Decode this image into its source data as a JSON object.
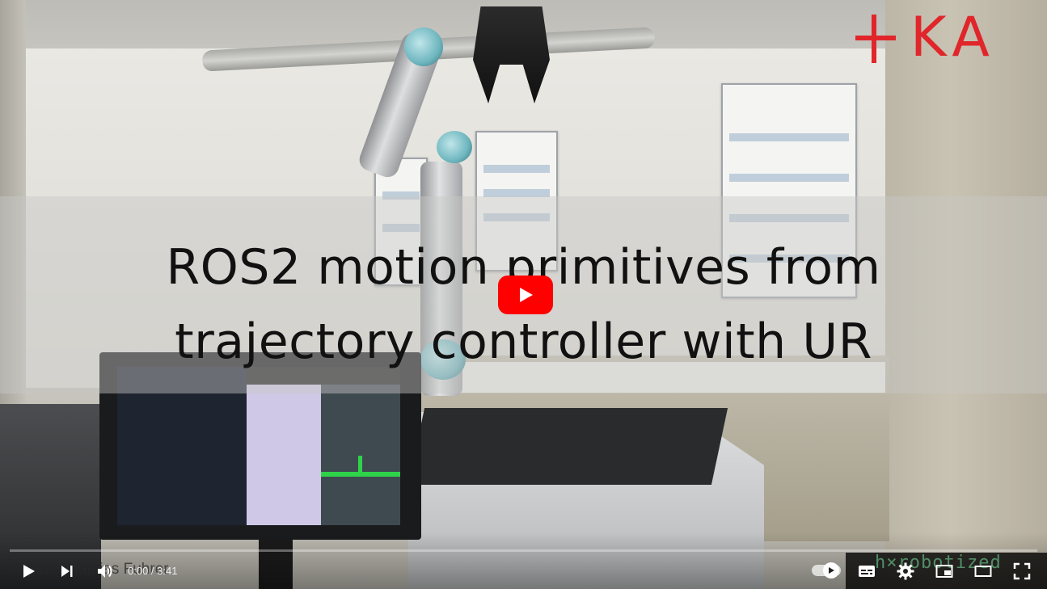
{
  "video": {
    "title_lines": [
      "ROS2 motion primitives from",
      "trajectory controller with UR"
    ],
    "logo_text": "KA",
    "watermark_left": "© 2025 Mathias Fuhrer",
    "watermark_right": "h×robotized",
    "current_time": "0:00",
    "separator": " / ",
    "duration": "3:41",
    "progress_played_fraction": 0.0
  },
  "controls": {
    "play_icon": "play-icon",
    "next_icon": "next-icon",
    "volume_icon": "volume-icon",
    "autoplay_icon": "autoplay-toggle-icon",
    "subtitles_icon": "subtitles-icon",
    "settings_icon": "gear-icon",
    "miniplayer_icon": "miniplayer-icon",
    "theater_icon": "theater-icon",
    "fullscreen_icon": "fullscreen-icon"
  },
  "colors": {
    "accent_red": "#ff0000",
    "logo_red": "#e0262b"
  }
}
